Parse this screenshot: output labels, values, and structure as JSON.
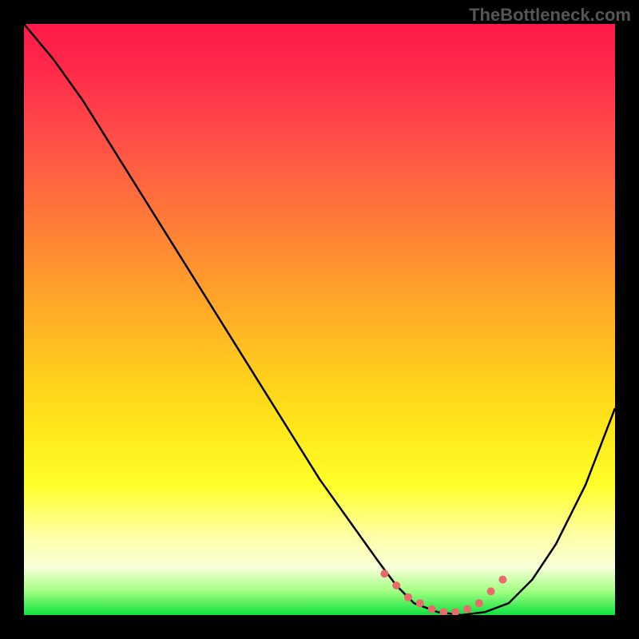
{
  "watermark": "TheBottleneck.com",
  "chart_data": {
    "type": "line",
    "title": "",
    "xlabel": "",
    "ylabel": "",
    "xlim": [
      0,
      100
    ],
    "ylim": [
      0,
      100
    ],
    "series": [
      {
        "name": "curve",
        "x": [
          0,
          5,
          10,
          15,
          20,
          25,
          30,
          35,
          40,
          45,
          50,
          55,
          60,
          63,
          66,
          70,
          74,
          78,
          82,
          86,
          90,
          95,
          100
        ],
        "y": [
          100,
          94,
          87,
          79,
          71,
          63,
          55,
          47,
          39,
          31,
          23,
          16,
          9,
          5,
          2,
          0.5,
          0,
          0.5,
          2,
          6,
          12,
          22,
          35
        ]
      },
      {
        "name": "highlight-dots",
        "x": [
          61,
          63,
          65,
          67,
          69,
          71,
          73,
          75,
          77,
          79,
          81
        ],
        "y": [
          7,
          5,
          3,
          2,
          1,
          0.5,
          0.5,
          1,
          2,
          4,
          6
        ]
      }
    ],
    "gradient_stops": [
      {
        "pos": 0.0,
        "color": "#ff1a4a"
      },
      {
        "pos": 0.5,
        "color": "#ffcc1e"
      },
      {
        "pos": 0.85,
        "color": "#ffff60"
      },
      {
        "pos": 1.0,
        "color": "#10e040"
      }
    ]
  }
}
